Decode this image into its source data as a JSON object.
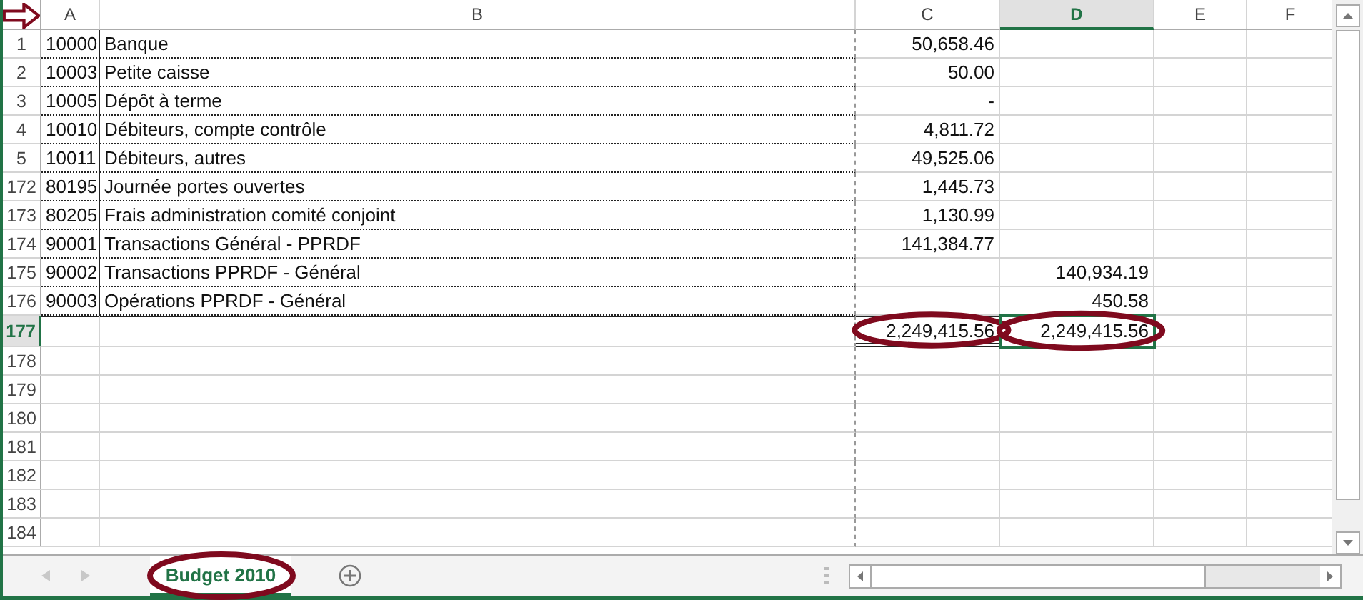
{
  "pointer_arrow": true,
  "columns": [
    {
      "label": "A",
      "selected": false
    },
    {
      "label": "B",
      "selected": false
    },
    {
      "label": "C",
      "selected": false
    },
    {
      "label": "D",
      "selected": true
    },
    {
      "label": "E",
      "selected": false
    },
    {
      "label": "F",
      "selected": false
    }
  ],
  "rows": [
    {
      "number": "1",
      "selected": false,
      "kind": "data",
      "cells": {
        "a": "10000",
        "b": "Banque",
        "c": "50,658.46"
      }
    },
    {
      "number": "2",
      "selected": false,
      "kind": "data",
      "cells": {
        "a": "10003",
        "b": "Petite caisse",
        "c": "50.00"
      }
    },
    {
      "number": "3",
      "selected": false,
      "kind": "data",
      "cells": {
        "a": "10005",
        "b": "Dépôt à terme",
        "c": "-"
      }
    },
    {
      "number": "4",
      "selected": false,
      "kind": "data",
      "cells": {
        "a": "10010",
        "b": "Débiteurs, compte contrôle",
        "c": "4,811.72"
      }
    },
    {
      "number": "5",
      "selected": false,
      "kind": "data",
      "cells": {
        "a": "10011",
        "b": "Débiteurs, autres",
        "c": "49,525.06"
      }
    },
    {
      "number": "172",
      "selected": false,
      "kind": "data",
      "cells": {
        "a": "80195",
        "b": "Journée portes ouvertes",
        "c": "1,445.73"
      }
    },
    {
      "number": "173",
      "selected": false,
      "kind": "data",
      "cells": {
        "a": "80205",
        "b": "Frais administration comité conjoint",
        "c": "1,130.99"
      }
    },
    {
      "number": "174",
      "selected": false,
      "kind": "data",
      "cells": {
        "a": "90001",
        "b": "Transactions Général - PPRDF",
        "c": "141,384.77"
      }
    },
    {
      "number": "175",
      "selected": false,
      "kind": "data",
      "cells": {
        "a": "90002",
        "b": "Transactions PPRDF - Général",
        "d": "140,934.19"
      }
    },
    {
      "number": "176",
      "selected": false,
      "kind": "data",
      "cells": {
        "a": "90003",
        "b": "Opérations PPRDF - Général",
        "d": "450.58"
      }
    },
    {
      "number": "177",
      "selected": true,
      "kind": "total",
      "circled": true,
      "cells": {
        "c": "2,249,415.56",
        "d": "2,249,415.56"
      }
    },
    {
      "number": "178",
      "selected": false,
      "kind": "empty",
      "cells": {}
    },
    {
      "number": "179",
      "selected": false,
      "kind": "empty",
      "cells": {}
    },
    {
      "number": "180",
      "selected": false,
      "kind": "empty",
      "cells": {}
    },
    {
      "number": "181",
      "selected": false,
      "kind": "empty",
      "cells": {}
    },
    {
      "number": "182",
      "selected": false,
      "kind": "empty",
      "cells": {}
    },
    {
      "number": "183",
      "selected": false,
      "kind": "empty",
      "cells": {}
    },
    {
      "number": "184",
      "selected": false,
      "kind": "empty",
      "cells": {}
    }
  ],
  "sheet_tabs": [
    {
      "label": "Budget 2010",
      "selected": true,
      "circled": true
    }
  ]
}
